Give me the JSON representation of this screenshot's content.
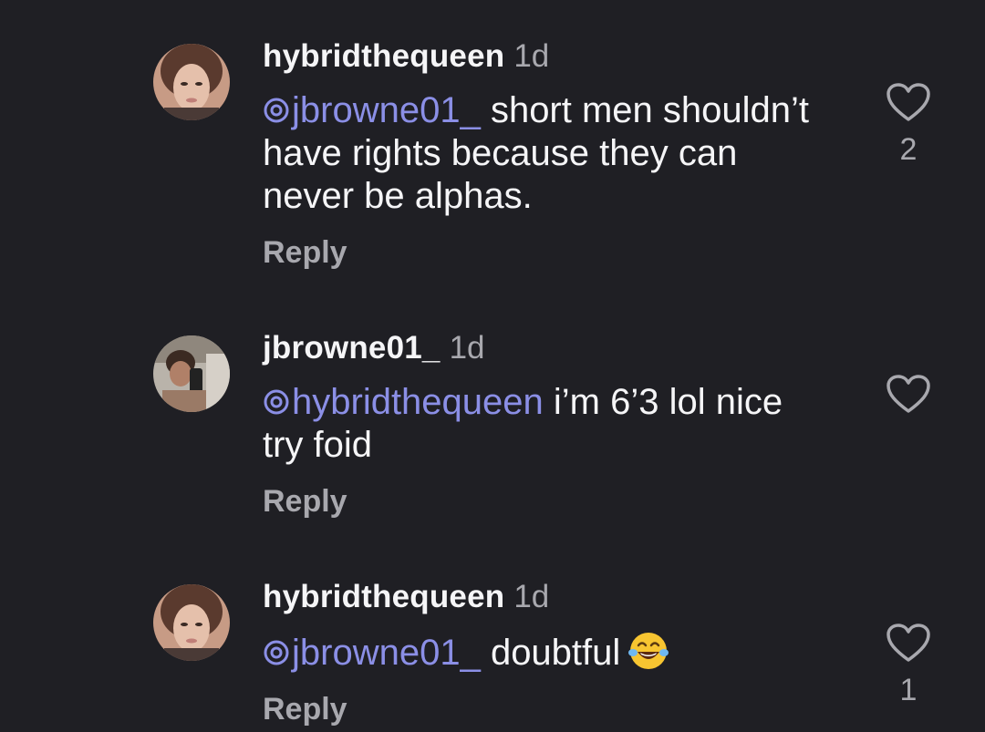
{
  "comments": [
    {
      "username": "hybridthequeen",
      "time": "1d",
      "mention": "jbrowne01_",
      "text": " short men shouldn’t have rights because they can never be alphas.",
      "reply_label": "Reply",
      "likes": "2",
      "avatar_icon": "profile-photo"
    },
    {
      "username": "jbrowne01_",
      "time": "1d",
      "mention": "hybridthequeen",
      "text": " i’m 6’3 lol nice try foid",
      "reply_label": "Reply",
      "likes": "",
      "avatar_icon": "profile-photo"
    },
    {
      "username": "hybridthequeen",
      "time": "1d",
      "mention": "jbrowne01_",
      "text": " doubtful",
      "emoji": "face-with-tears-of-joy",
      "reply_label": "Reply",
      "likes": "1",
      "avatar_icon": "profile-photo"
    }
  ],
  "colors": {
    "background": "#1f1f24",
    "mention": "#8b8fe6",
    "secondary_text": "#a8a8ae"
  }
}
